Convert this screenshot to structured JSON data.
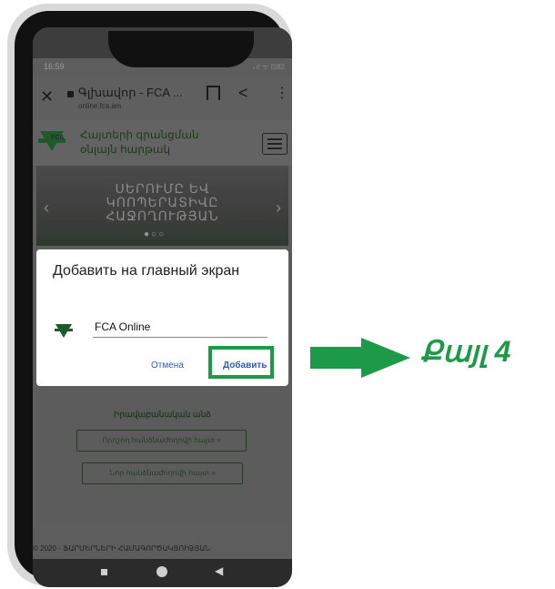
{
  "status": {
    "time": "16:59",
    "icons": "₊ıl ᯤ ⊡82"
  },
  "browser": {
    "page_title": "Գլխավոր - FCA ...",
    "url": "online.fca.am",
    "close_symbol": "✕",
    "share_symbol": "<",
    "menu_symbol": "⋮"
  },
  "site": {
    "logo_text": "FCA",
    "title_line1": "Հայտերի գրանցման",
    "title_line2": "օնլայն հարթակ"
  },
  "banner": {
    "line1": "ՍԵՐՈՒՄԸ ԵՎ",
    "line2": "ԿՈՈՊԵՐԱՏԻՎԸ",
    "line3": "ՀԱՋՈՂՈՒԹՅԱՆ",
    "dots": "●○○",
    "prev": "‹",
    "next": "›"
  },
  "dialog": {
    "title": "Добавить на главный экран",
    "input_value": "FCA Online",
    "cancel_label": "Отмена",
    "add_label": "Добавить"
  },
  "lower": {
    "heading": "Իրավաբանական անձ",
    "button1": "Որոշող հանձնաժողովի հայտ »",
    "button2": "Նոր հանձնաժողովի հայտ »"
  },
  "footer": {
    "text": "© 2020 - ՖԱՐՄԵՐՆԵՐԻ ՀԱՄԱԳՈՐԾԱԿՑՈՒԹՅԱՆ"
  },
  "step": {
    "label": "Քայլ 4"
  },
  "colors": {
    "accent_green": "#1d9a48",
    "link_blue": "#2e5bbf"
  }
}
